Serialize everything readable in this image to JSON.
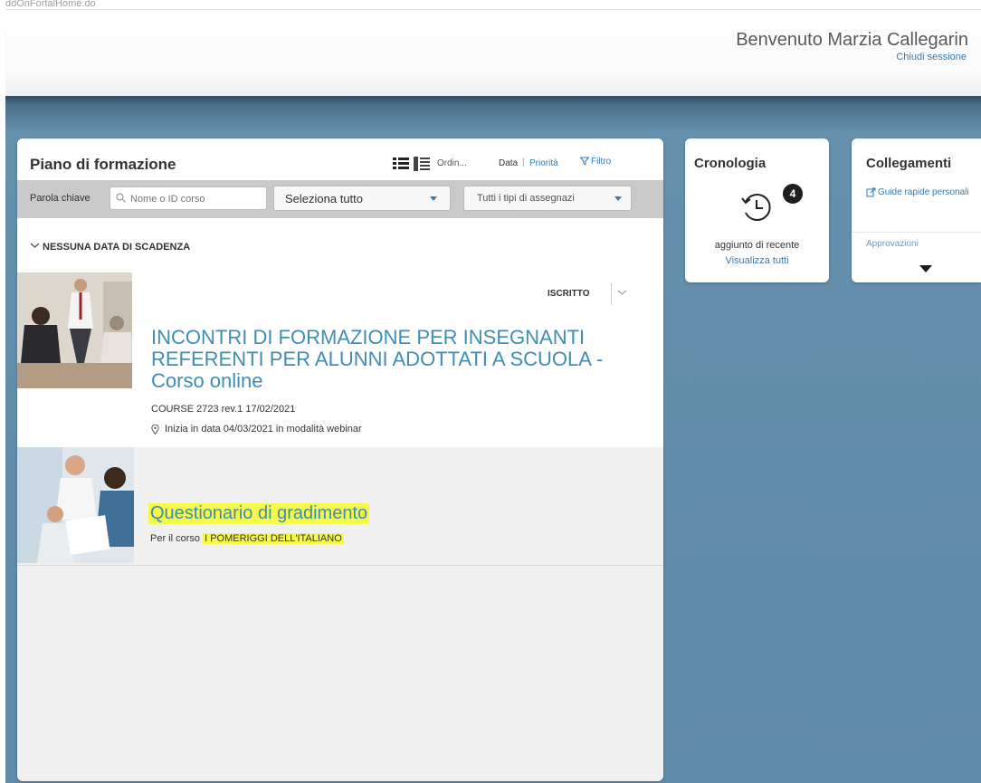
{
  "browser": {
    "url_fragment": "ddOnFortalHome.do"
  },
  "header": {
    "welcome": "Benvenuto Marzia Callegarin",
    "logout": "Chiudi sessione"
  },
  "plan": {
    "title": "Piano di formazione",
    "sort_label": "Ordin...",
    "sort_data": "Data",
    "sort_sep": "|",
    "sort_priority": "Priorità",
    "filter": "Filtro",
    "keyword_label": "Parola chiave",
    "search_placeholder": "Nome o ID corso",
    "select_all": "Seleziona tutto",
    "assignment_types": "Tutti i tipi di assegnazi",
    "group_label": "NESSUNA DATA DI SCADENZA",
    "courses": [
      {
        "status": "ISCRITTO",
        "title": "INCONTRI DI FORMAZIONE PER INSEGNANTI REFERENTI PER ALUNNI ADOTTATI A SCUOLA - Corso online",
        "meta": "COURSE 2723 rev.1 17/02/2021",
        "location": "Inizia in data 04/03/2021 in modalità webinar"
      }
    ],
    "survey": {
      "title": "Questionario di gradimento",
      "prefix": "Per il corso",
      "course": "I POMERIGGI DELL'ITALIANO"
    }
  },
  "history": {
    "title": "Cronologia",
    "count": "4",
    "caption": "aggiunto di recente",
    "view_all": "Visualizza tutti"
  },
  "links": {
    "title": "Collegamenti",
    "guide": "Guide rapide personali",
    "approvals": "Approvazioni"
  },
  "colors": {
    "accent": "#3a79a8",
    "title_blue": "#3f8eb2",
    "highlight": "#f4f94a",
    "background_blue": "#6690ac"
  }
}
